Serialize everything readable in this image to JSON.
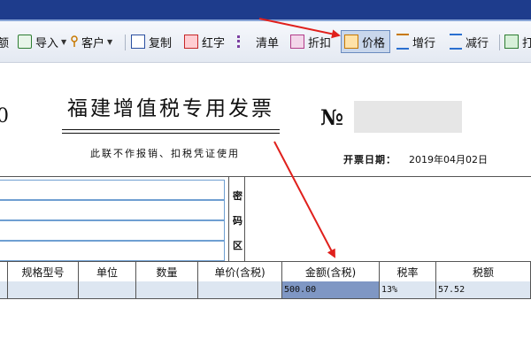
{
  "toolbar": {
    "items": [
      {
        "label": "额",
        "has_caret": false,
        "icon": "partial-icon"
      },
      {
        "label": "导入",
        "has_caret": true,
        "icon": "import-icon"
      },
      {
        "label": "客户",
        "has_caret": true,
        "icon": "customer-icon"
      },
      {
        "label": "复制",
        "has_caret": false,
        "icon": "copy-icon"
      },
      {
        "label": "红字",
        "has_caret": false,
        "icon": "red-invoice-icon"
      },
      {
        "label": "清单",
        "has_caret": false,
        "icon": "list-icon"
      },
      {
        "label": "折扣",
        "has_caret": false,
        "icon": "discount-icon"
      },
      {
        "label": "价格",
        "has_caret": false,
        "icon": "price-icon",
        "active": true
      },
      {
        "label": "增行",
        "has_caret": false,
        "icon": "add-row-icon"
      },
      {
        "label": "减行",
        "has_caret": false,
        "icon": "delete-row-icon"
      },
      {
        "label": "打",
        "has_caret": false,
        "icon": "print-icon"
      }
    ]
  },
  "invoice": {
    "left_digit": "0",
    "title": "福建增值税专用发票",
    "subtitle": "此联不作报销、扣税凭证使用",
    "no_label": "№",
    "date_label": "开票日期：",
    "date_value": "2019年04月02日",
    "password_area": [
      "密",
      "码",
      "区"
    ]
  },
  "table": {
    "headers": [
      "规格型号",
      "单位",
      "数量",
      "单价(含税)",
      "金额(含税)",
      "税率",
      "税额"
    ],
    "row": [
      "",
      "",
      "",
      "",
      "500.00",
      "13%",
      "57.52"
    ]
  },
  "colors": {
    "titlebar": "#1e3c8c",
    "selected_cell": "#7f97c4",
    "row_bg": "#dde6f1",
    "arrow": "#e0201c"
  }
}
